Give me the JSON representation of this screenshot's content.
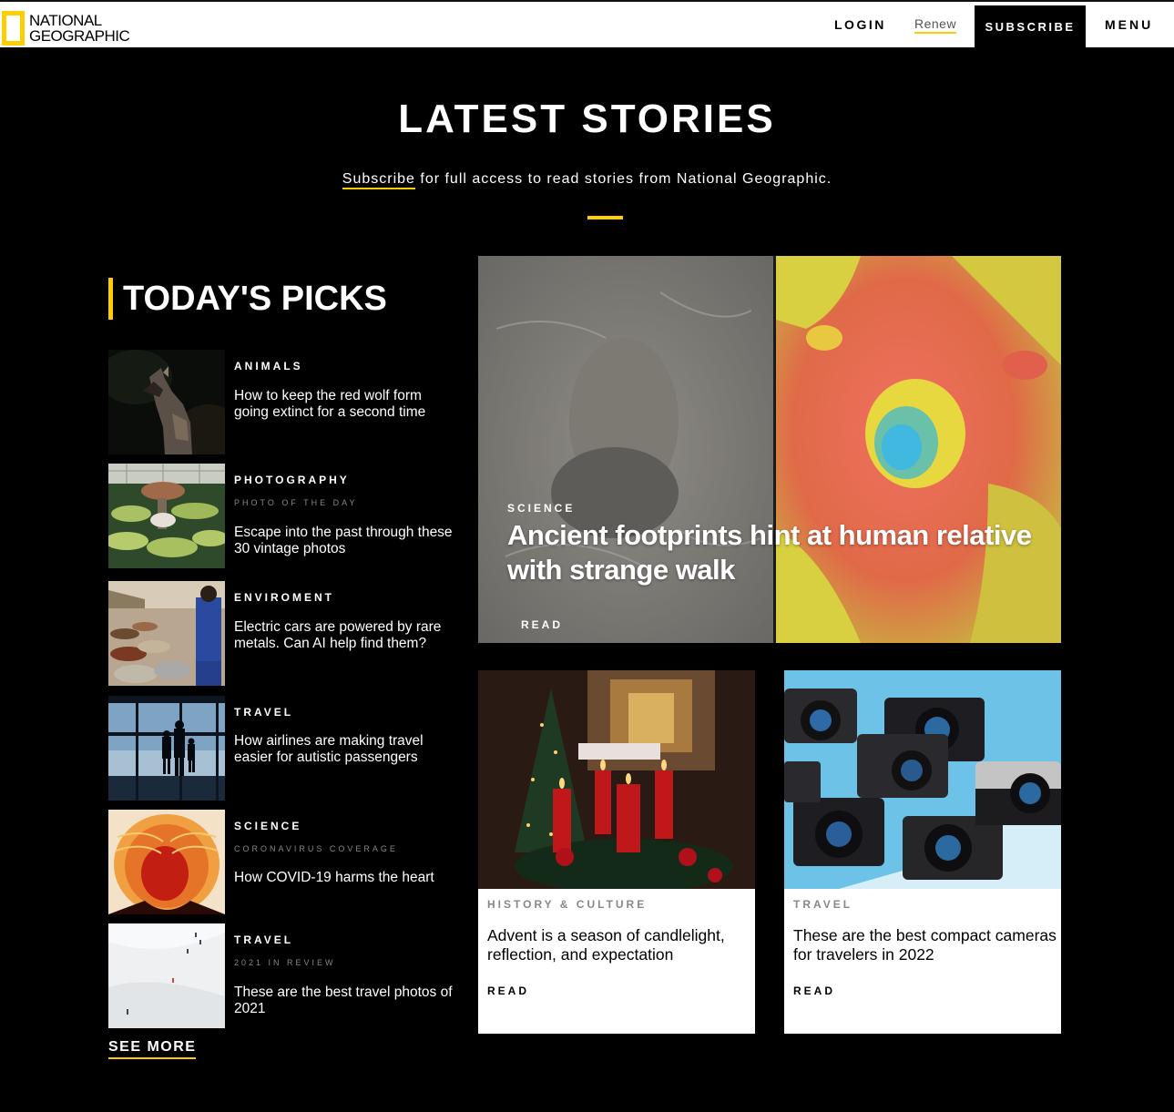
{
  "header": {
    "logo_line1": "NATIONAL",
    "logo_line2": "GEOGRAPHIC",
    "login": "LOGIN",
    "renew": "Renew",
    "subscribe": "SUBSCRIBE",
    "menu": "MENU"
  },
  "hero": {
    "title": "LATEST STORIES",
    "subscribe_link": "Subscribe",
    "subscribe_rest": " for full access to read stories from National Geographic."
  },
  "picks": {
    "heading": "TODAY'S PICKS",
    "items": [
      {
        "category": "ANIMALS",
        "kicker": "",
        "title": "How to keep the red wolf form going extinct for a second time",
        "image": "howling-wolf"
      },
      {
        "category": "PHOTOGRAPHY",
        "kicker": "PHOTO OF THE DAY",
        "title": "Escape into the past through these 30 vintage photos",
        "image": "lily-pads"
      },
      {
        "category": "ENVIROMENT",
        "kicker": "",
        "title": "Electric cars are powered by rare metals. Can AI help find them?",
        "image": "mineral-samples"
      },
      {
        "category": "TRAVEL",
        "kicker": "",
        "title": "How airlines are making travel easier for autistic passengers",
        "image": "airport-window-family"
      },
      {
        "category": "SCIENCE",
        "kicker": "CORONAVIRUS COVERAGE",
        "title": "How COVID-19 harms the heart",
        "image": "chest-xray"
      },
      {
        "category": "TRAVEL",
        "kicker": "2021 IN REVIEW",
        "title": "These are the best travel photos of 2021",
        "image": "snow-field-skiers"
      }
    ],
    "see_more": "SEE MORE"
  },
  "feature": {
    "category": "SCIENCE",
    "title": "Ancient footprints hint at human relative with strange walk",
    "read": "READ",
    "image": "footprint-scan"
  },
  "cards": [
    {
      "category": "HISTORY & CULTURE",
      "title": "Advent is a season of candlelight, reflection, and expectation",
      "read": "READ",
      "image": "advent-candles"
    },
    {
      "category": "TRAVEL",
      "title": "These are the best compact cameras for travelers in 2022",
      "read": "READ",
      "image": "compact-cameras"
    }
  ],
  "colors": {
    "accent": "#ffce00",
    "background": "#000000"
  }
}
